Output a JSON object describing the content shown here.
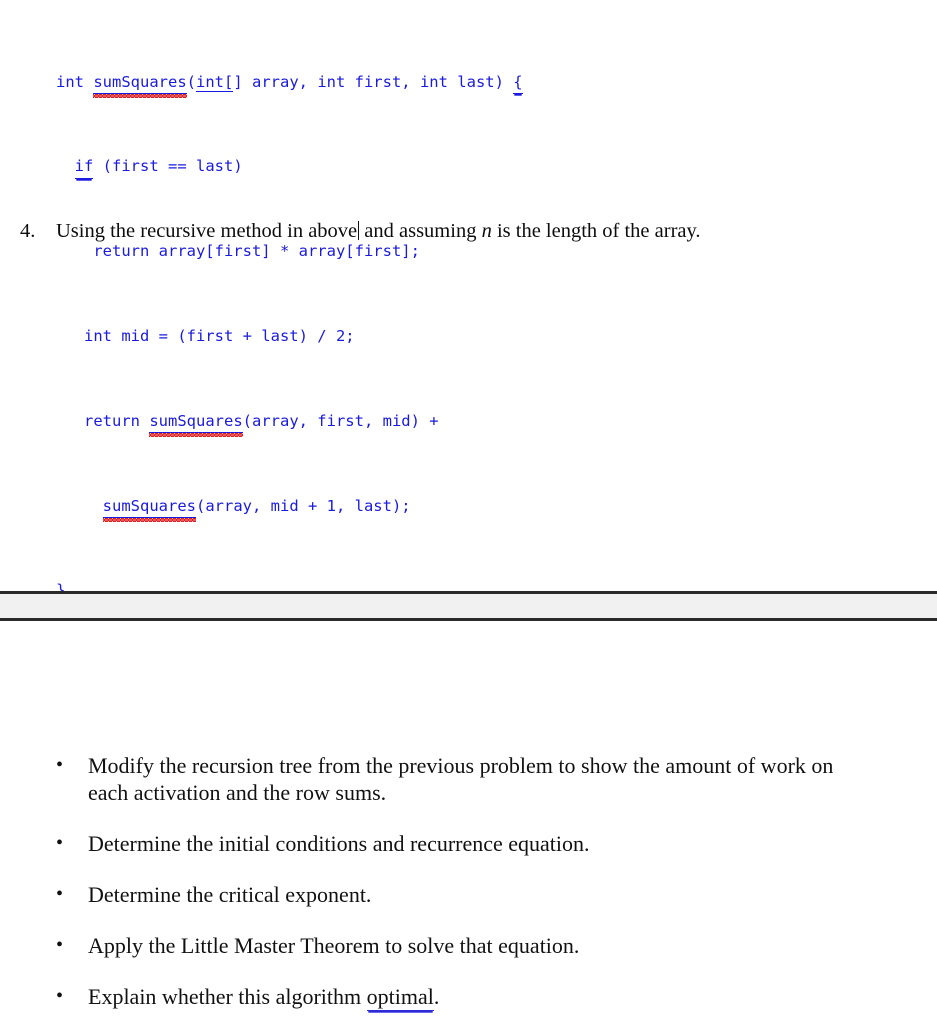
{
  "document": {
    "code_block": {
      "language": "java",
      "text_color": "#1a1ae0",
      "lines": [
        {
          "id": "line-1",
          "segments": [
            {
              "text": "int ",
              "mark": "none"
            },
            {
              "text": "sumSquares",
              "mark": "blue-underline-red-squiggle"
            },
            {
              "text": "(",
              "mark": "none"
            },
            {
              "text": "int[",
              "mark": "blue-underline"
            },
            {
              "text": "] array, int first, int last) ",
              "mark": "none"
            },
            {
              "text": "{",
              "mark": "blue-double-underline"
            }
          ],
          "plain": "int sumSquares(int[] array, int first, int last) {"
        },
        {
          "id": "line-2",
          "segments": [
            {
              "text": "  ",
              "mark": "none"
            },
            {
              "text": "if",
              "mark": "blue-double-underline"
            },
            {
              "text": " (first == last)",
              "mark": "none"
            }
          ],
          "plain": "  if (first == last)"
        },
        {
          "id": "line-3",
          "segments": [
            {
              "text": "    return array[first] * array[first];",
              "mark": "none"
            }
          ],
          "plain": "    return array[first] * array[first];"
        },
        {
          "id": "line-4",
          "segments": [
            {
              "text": "   int mid = (first + last) / 2;",
              "mark": "none"
            }
          ],
          "plain": "   int mid = (first + last) / 2;"
        },
        {
          "id": "line-5",
          "segments": [
            {
              "text": "   return ",
              "mark": "none"
            },
            {
              "text": "sumSquares",
              "mark": "blue-underline-red-squiggle"
            },
            {
              "text": "(array, first, mid) +",
              "mark": "none"
            }
          ],
          "plain": "   return sumSquares(array, first, mid) +"
        },
        {
          "id": "line-6",
          "segments": [
            {
              "text": "     ",
              "mark": "none"
            },
            {
              "text": "sumSquares",
              "mark": "blue-underline-red-squiggle"
            },
            {
              "text": "(array, mid + 1, last);",
              "mark": "none"
            }
          ],
          "plain": "     sumSquares(array, mid + 1, last);"
        },
        {
          "id": "line-7",
          "segments": [
            {
              "text": "}",
              "mark": "none"
            }
          ],
          "plain": "}"
        }
      ]
    },
    "numbered_item": {
      "number": "4.",
      "text_before_caret": "Using the recursive method in above",
      "text_after_caret": " and assuming ",
      "italic_variable": "n",
      "text_tail": " is the length of the array.",
      "caret_present": true
    },
    "page_break": {
      "band_color": "#f1f1f1",
      "line_color": "#2b2b2b"
    },
    "bullet_list": {
      "marker": "•",
      "items": [
        {
          "id": "bullet-1",
          "text": "Modify the recursion tree from the previous problem to show the amount of work on each activation and the row sums."
        },
        {
          "id": "bullet-2",
          "text": "Determine the initial conditions and recurrence equation."
        },
        {
          "id": "bullet-3",
          "text": "Determine the critical exponent."
        },
        {
          "id": "bullet-4",
          "text": "Apply the Little Master Theorem to solve that equation."
        },
        {
          "id": "bullet-5",
          "text_before": "Explain whether this algorithm ",
          "marked_word": "optimal",
          "text_after": ".",
          "mark_type": "blue-double-underline",
          "mark_color": "#2b2bd8"
        }
      ]
    }
  }
}
